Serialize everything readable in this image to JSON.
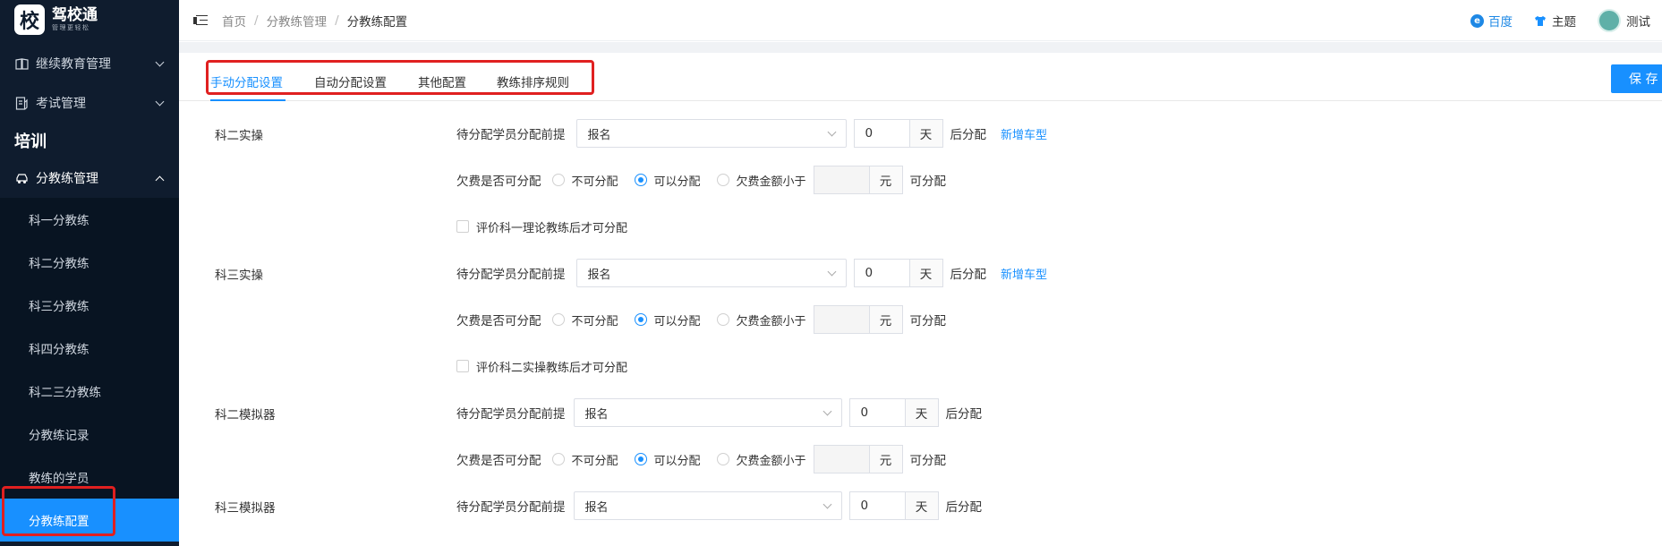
{
  "logo": {
    "char": "校",
    "name": "驾校通",
    "sub": "管理更轻松"
  },
  "sidebar": {
    "groups": [
      {
        "label": "继续教育管理",
        "icon": "book-icon"
      },
      {
        "label": "考试管理",
        "icon": "exam-icon"
      }
    ],
    "section_title": "培训",
    "open_group": {
      "label": "分教练管理",
      "icon": "car-icon"
    },
    "items": [
      {
        "label": "科一分教练"
      },
      {
        "label": "科二分教练"
      },
      {
        "label": "科三分教练"
      },
      {
        "label": "科四分教练"
      },
      {
        "label": "科二三分教练"
      },
      {
        "label": "分教练记录"
      },
      {
        "label": "教练的学员"
      },
      {
        "label": "分教练配置"
      }
    ],
    "active_item": "分教练配置"
  },
  "header": {
    "breadcrumb": [
      "首页",
      "分教练管理",
      "分教练配置"
    ],
    "baidu": "百度",
    "theme": "主题",
    "user": "测试"
  },
  "tabs": [
    "手动分配设置",
    "自动分配设置",
    "其他配置",
    "教练排序规则"
  ],
  "active_tab": "手动分配设置",
  "save_label": "保 存",
  "form": {
    "prereq_label": "待分配学员分配前提",
    "after_label": "后分配",
    "day_unit": "天",
    "yuan_unit": "元",
    "add_car_type": "新增车型",
    "fee_label": "欠费是否可分配",
    "options": [
      "不可分配",
      "可以分配",
      "欠费金额小于"
    ],
    "can_assign": "可分配",
    "sections": [
      {
        "name": "科二实操",
        "prereq": "报名",
        "days": "0",
        "fee_choice": "可以分配",
        "check": "评价科一理论教练后才可分配"
      },
      {
        "name": "科三实操",
        "prereq": "报名",
        "days": "0",
        "fee_choice": "可以分配",
        "check": "评价科二实操教练后才可分配"
      },
      {
        "name": "科二模拟器",
        "prereq": "报名",
        "days": "0",
        "fee_choice": "可以分配"
      },
      {
        "name": "科三模拟器",
        "prereq": "报名",
        "days": "0"
      }
    ]
  },
  "colors": {
    "accent": "#1890ff",
    "sidebar_bg": "#0f1c2e",
    "highlight": "#e02020"
  }
}
